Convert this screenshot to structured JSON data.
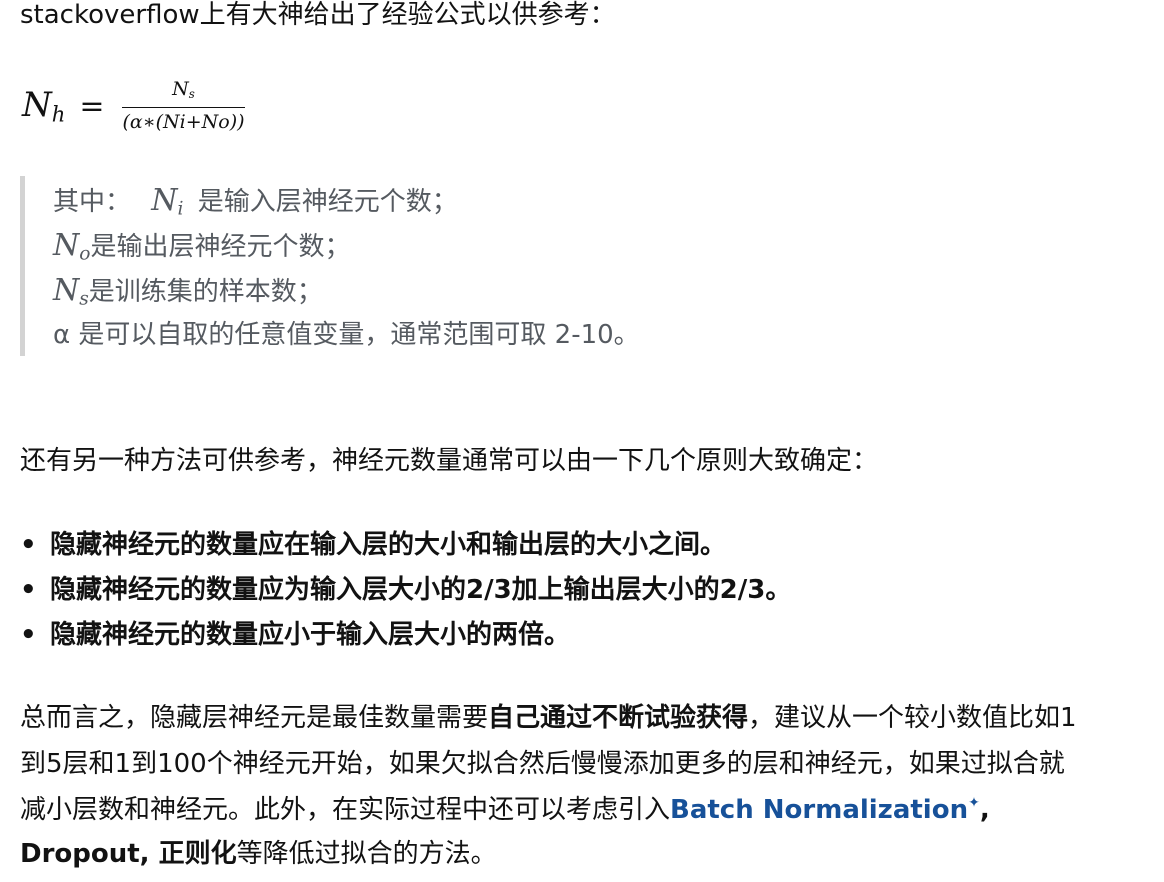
{
  "intro": {
    "text": "stackoverflow上有大神给出了经验公式以供参考："
  },
  "formula": {
    "lhs_var": "N",
    "lhs_sub": "h",
    "equals": "=",
    "numerator_var": "N",
    "numerator_sub": "s",
    "denominator": "(α∗(Ni+No))"
  },
  "quote": {
    "line1_prefix": "其中：",
    "line1_var": "N",
    "line1_sub": "i",
    "line1_text": "是输入层神经元个数；",
    "line2_var": "N",
    "line2_sub": "o",
    "line2_text": "是输出层神经元个数；",
    "line3_var": "N",
    "line3_sub": "s",
    "line3_text": "是训练集的样本数；",
    "line4_text": "α 是可以自取的任意值变量，通常范围可取 2-10。"
  },
  "method_intro": "还有另一种方法可供参考，神经元数量通常可以由一下几个原则大致确定：",
  "bullets": [
    "隐藏神经元的数量应在输入层的大小和输出层的大小之间。",
    "隐藏神经元的数量应为输入层大小的2/3加上输出层大小的2/3。",
    "隐藏神经元的数量应小于输入层大小的两倍。"
  ],
  "bullet_symbol": "•",
  "summary": {
    "line1_a": "总而言之，隐藏层神经元是最佳数量需要",
    "line1_bold": "自己通过不断试验获得",
    "line1_b": "，建议从一个较小数值比如1",
    "line2": "到5层和1到100个神经元开始，如果欠拟合然后慢慢添加更多的层和神经元，如果过拟合就",
    "line3_a": "减小层数和神经元。此外，在实际过程中还可以考虑引入",
    "line3_link": "Batch Normalization",
    "line3_link_sup": "✦",
    "line3_b": ",",
    "line4_bold": "Dropout, 正则化",
    "line4_rest": "等降低过拟合的方法。"
  }
}
